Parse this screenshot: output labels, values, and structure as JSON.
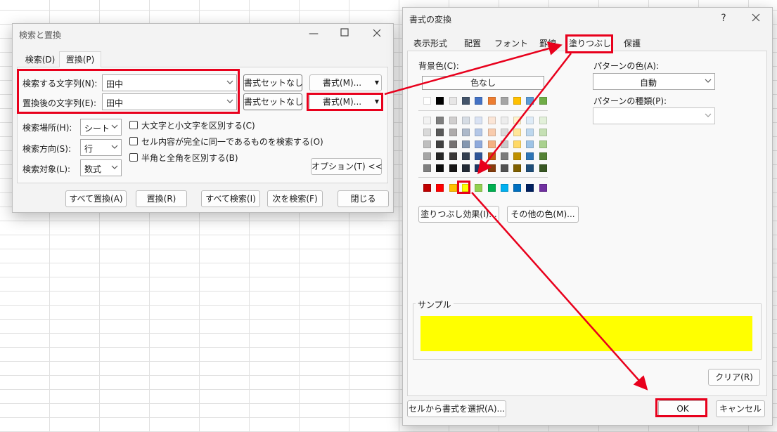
{
  "find_replace": {
    "title": "検索と置換",
    "tabs": [
      "検索(D)",
      "置換(P)"
    ],
    "find_label": "検索する文字列(N):",
    "find_value": "田中",
    "replace_label": "置換後の文字列(E):",
    "replace_value": "田中",
    "no_format_label": "書式セットなし",
    "format_button": "書式(M)...",
    "within_label": "検索場所(H):",
    "within_value": "シート",
    "search_label": "検索方向(S):",
    "search_value": "行",
    "lookin_label": "検索対象(L):",
    "lookin_value": "数式",
    "match_case": "大文字と小文字を区別する(C)",
    "match_entire": "セル内容が完全に同一であるものを検索する(O)",
    "match_byte": "半角と全角を区別する(B)",
    "options_button": "オプション(T) <<",
    "buttons": {
      "replace_all": "すべて置換(A)",
      "replace": "置換(R)",
      "find_all": "すべて検索(I)",
      "find_next": "次を検索(F)",
      "close": "閉じる"
    }
  },
  "format_cells": {
    "title": "書式の変換",
    "help": "?",
    "tabs": [
      "表示形式",
      "配置",
      "フォント",
      "罫線",
      "塗りつぶし",
      "保護"
    ],
    "active_tab": "塗りつぶし",
    "bg_color_label": "背景色(C):",
    "no_color": "色なし",
    "pattern_color_label": "パターンの色(A):",
    "pattern_color_value": "自動",
    "pattern_style_label": "パターンの種類(P):",
    "fill_effects": "塗りつぶし効果(I)...",
    "more_colors": "その他の色(M)...",
    "sample_label": "サンプル",
    "sample_color": "#ffff00",
    "clear": "クリア(R)",
    "choose_from_cell": "セルから書式を選択(A)...",
    "ok": "OK",
    "cancel": "キャンセル",
    "theme_row": [
      "#ffffff",
      "#000000",
      "#e7e6e6",
      "#44546a",
      "#4472c4",
      "#ed7d31",
      "#a5a5a5",
      "#ffc000",
      "#5b9bd5",
      "#70ad47"
    ],
    "shade_rows": [
      [
        "#f2f2f2",
        "#7f7f7f",
        "#d0cece",
        "#d6dce4",
        "#d9e2f3",
        "#fbe5d6",
        "#ededed",
        "#fff2cc",
        "#deebf7",
        "#e2f0d9"
      ],
      [
        "#d9d9d9",
        "#595959",
        "#aeabab",
        "#adb9ca",
        "#b4c7e7",
        "#f8cbad",
        "#dbdbdb",
        "#ffe699",
        "#bdd7ee",
        "#c5e0b4"
      ],
      [
        "#bfbfbf",
        "#404040",
        "#757171",
        "#8497b0",
        "#8faadc",
        "#f4b183",
        "#c9c9c9",
        "#ffd966",
        "#9dc3e6",
        "#a9d18e"
      ],
      [
        "#a6a6a6",
        "#262626",
        "#3a3838",
        "#333f50",
        "#2f5597",
        "#c55a11",
        "#7b7b7b",
        "#bf9000",
        "#2e75b6",
        "#548235"
      ],
      [
        "#808080",
        "#0d0d0d",
        "#171616",
        "#222a35",
        "#1f3864",
        "#843c0c",
        "#525252",
        "#7f6000",
        "#1f4e79",
        "#385723"
      ]
    ],
    "standard_row": [
      "#c00000",
      "#ff0000",
      "#ffc000",
      "#ffff00",
      "#92d050",
      "#00b050",
      "#00b0f0",
      "#0070c0",
      "#002060",
      "#7030a0"
    ]
  }
}
